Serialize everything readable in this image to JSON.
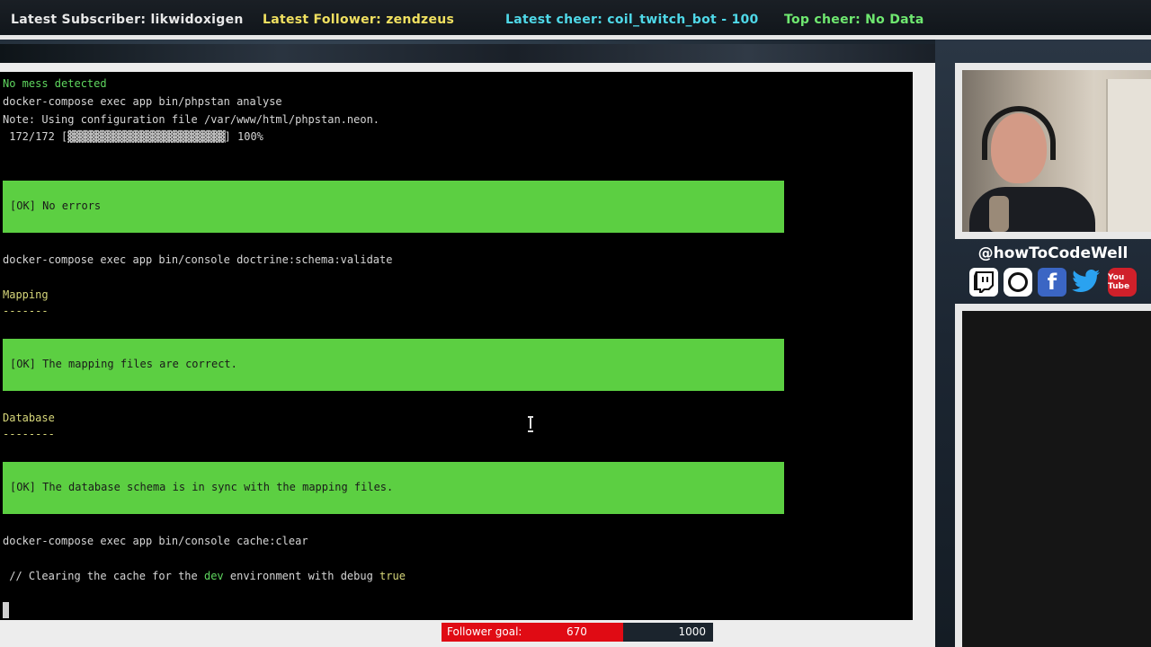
{
  "topbar": {
    "latest_subscriber": "Latest Subscriber: likwidoxigen",
    "latest_follower": "Latest Follower: zendzeus",
    "latest_cheer": "Latest cheer: coil_twitch_bot - 100",
    "top_cheer": "Top cheer: No Data"
  },
  "terminal": {
    "line1": "No mess detected",
    "line2": "docker-compose exec app bin/phpstan analyse",
    "line3": "Note: Using configuration file /var/www/html/phpstan.neon.",
    "progress_count": " 172/172 [",
    "progress_blocks": "▓▓▓▓▓▓▓▓▓▓▓▓▓▓▓▓▓▓▓▓▓▓▓▓▓▓▓▓",
    "progress_end": "] 100%",
    "ok1": "[OK] No errors",
    "line4": "docker-compose exec app bin/console doctrine:schema:validate",
    "mapping_heading": "Mapping",
    "mapping_underline": "-------",
    "ok2": "[OK] The mapping files are correct.",
    "database_heading": "Database",
    "database_underline": "--------",
    "ok3": "[OK] The database schema is in sync with the mapping files.",
    "line5": "docker-compose exec app bin/console cache:clear",
    "clear_prefix": " // Clearing the cache for the ",
    "clear_env": "dev",
    "clear_mid": " environment with debug ",
    "clear_debug": "true"
  },
  "sidebar": {
    "handle": "@howToCodeWell",
    "social_icons": [
      "twitch-icon",
      "instagram-icon",
      "facebook-icon",
      "twitter-icon",
      "youtube-icon"
    ],
    "facebook_glyph": "f",
    "youtube_glyph": "You Tube"
  },
  "follower_goal": {
    "label": "Follower goal:",
    "current": "670",
    "target": "1000",
    "progress_fraction": 0.67
  },
  "colors": {
    "ok_green": "#5ccf42",
    "goal_red": "#e00b14",
    "heading_yellow": "#d7d77a"
  }
}
